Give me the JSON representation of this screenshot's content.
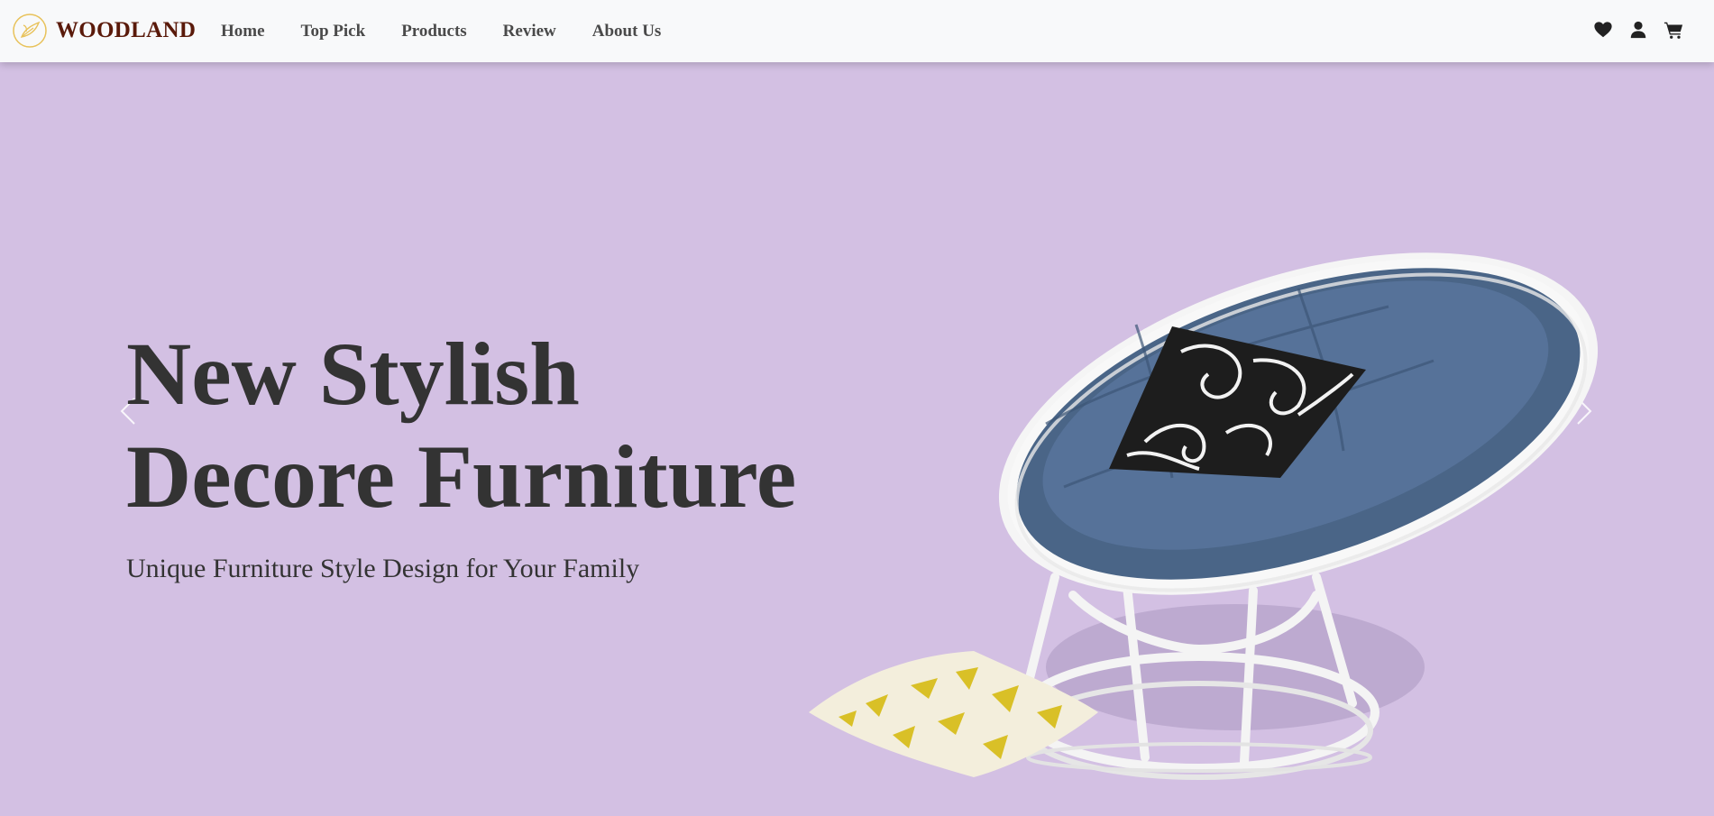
{
  "brand": {
    "name": "WOODLAND",
    "logo_icon": "leaf-emblem-icon",
    "color": "#5a1a0a",
    "logo_color": "#e8c25a"
  },
  "nav": {
    "links": [
      {
        "label": "Home"
      },
      {
        "label": "Top Pick"
      },
      {
        "label": "Products"
      },
      {
        "label": "Review"
      },
      {
        "label": "About Us"
      }
    ],
    "icons": [
      "heart-icon",
      "user-icon",
      "cart-icon"
    ]
  },
  "hero": {
    "title_line1": "New Stylish",
    "title_line2": "Decore Furniture",
    "subtitle": "Unique Furniture Style Design for Your Family",
    "background_color": "#d3c0e3",
    "text_color": "#333333",
    "image": "papasan-chair-image",
    "prev_icon": "chevron-left-icon",
    "next_icon": "chevron-right-icon"
  }
}
